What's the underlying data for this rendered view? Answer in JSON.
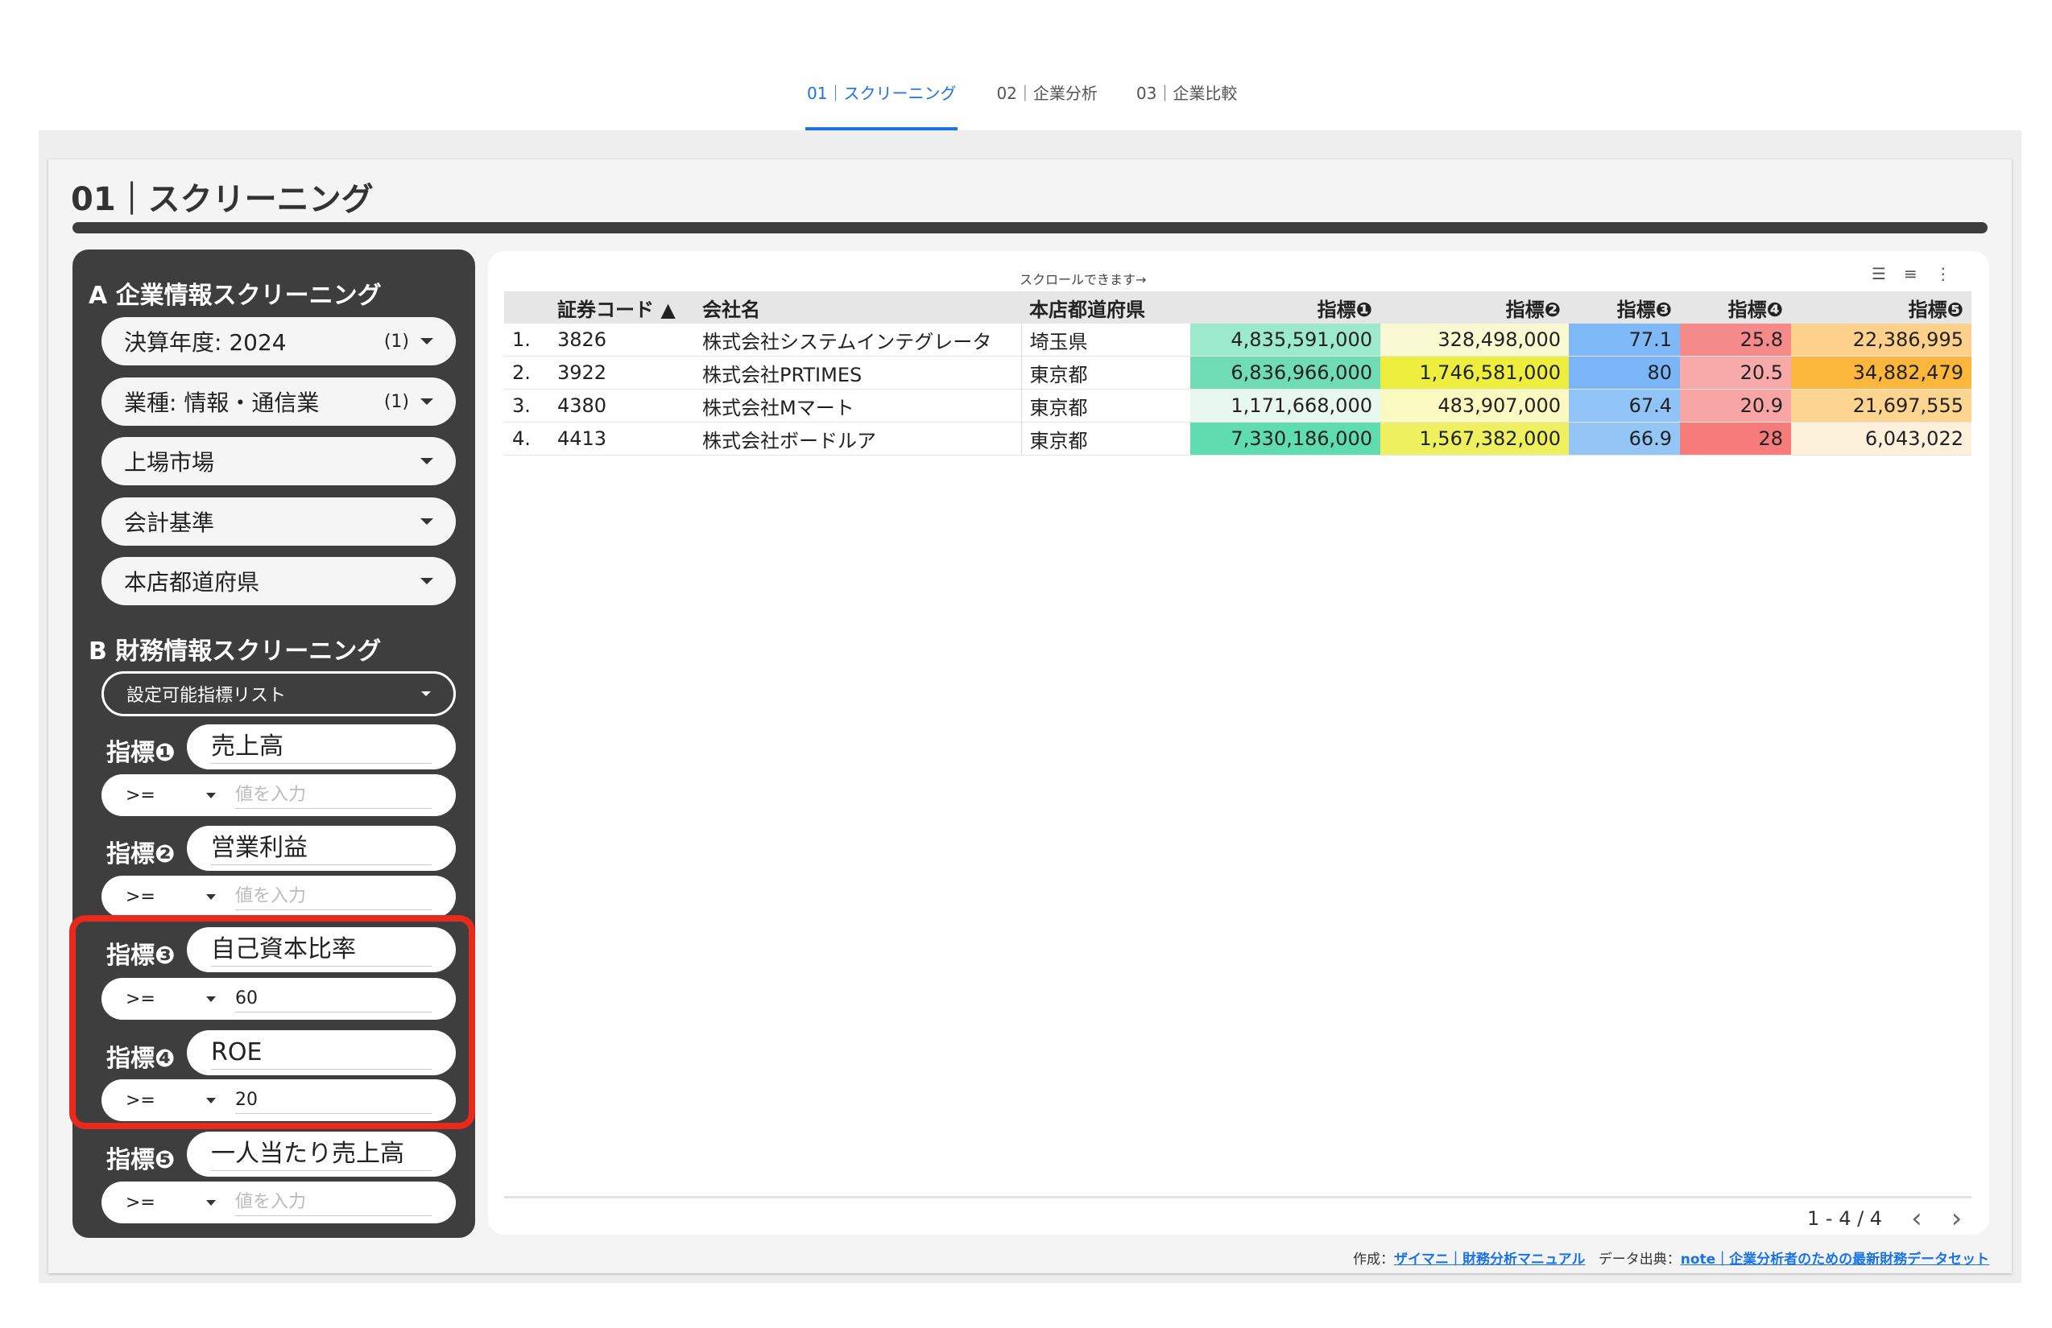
{
  "nav": {
    "tabs": [
      {
        "label": "01｜スクリーニング"
      },
      {
        "label": "02｜企業分析"
      },
      {
        "label": "03｜企業比較"
      }
    ]
  },
  "page": {
    "title": "01｜スクリーニング"
  },
  "filters": {
    "section_a_title": "A 企業情報スクリーニング",
    "dropdowns": [
      {
        "label": "決算年度: 2024",
        "count": "(1)"
      },
      {
        "label": "業種: 情報・通信業",
        "count": "(1)"
      },
      {
        "label": "上場市場",
        "count": ""
      },
      {
        "label": "会計基準",
        "count": ""
      },
      {
        "label": "本店都道府県",
        "count": ""
      }
    ],
    "section_b_title": "B 財務情報スクリーニング",
    "indicator_list_label": "設定可能指標リスト",
    "indicators": [
      {
        "label": "指標❶",
        "metric": "売上高",
        "operator": ">=",
        "value": "",
        "placeholder": "値を入力"
      },
      {
        "label": "指標❷",
        "metric": "営業利益",
        "operator": ">=",
        "value": "",
        "placeholder": "値を入力"
      },
      {
        "label": "指標❸",
        "metric": "自己資本比率",
        "operator": ">=",
        "value": "60",
        "placeholder": ""
      },
      {
        "label": "指標❹",
        "metric": "ROE",
        "operator": ">=",
        "value": "20",
        "placeholder": ""
      },
      {
        "label": "指標❺",
        "metric": "一人当たり売上高",
        "operator": ">=",
        "value": "",
        "placeholder": "値を入力"
      }
    ]
  },
  "table": {
    "scroll_hint": "スクロールできます→",
    "columns": [
      "",
      "証券コード ▲",
      "会社名",
      "本店都道府県",
      "指標❶",
      "指標❷",
      "指標❸",
      "指標❹",
      "指標❺"
    ],
    "rows": [
      [
        "1.",
        "3826",
        "株式会社システムインテグレータ",
        "埼玉県",
        "4,835,591,000",
        "328,498,000",
        "77.1",
        "25.8",
        "22,386,995"
      ],
      [
        "2.",
        "3922",
        "株式会社PRTIMES",
        "東京都",
        "6,836,966,000",
        "1,746,581,000",
        "80",
        "20.5",
        "34,882,479"
      ],
      [
        "3.",
        "4380",
        "株式会社Mマート",
        "東京都",
        "1,171,668,000",
        "483,907,000",
        "67.4",
        "20.9",
        "21,697,555"
      ],
      [
        "4.",
        "4413",
        "株式会社ボードルア",
        "東京都",
        "7,330,186,000",
        "1,567,382,000",
        "66.9",
        "28",
        "6,043,022"
      ]
    ],
    "cell_colors": [
      [
        "#9de9cc",
        "#fafad2",
        "#7fb8f7",
        "#f48a8a",
        "#fdd08c"
      ],
      [
        "#6fdcb5",
        "#eeee3f",
        "#7ab5f8",
        "#f8a9a9",
        "#fbb73b"
      ],
      [
        "#e8f8f1",
        "#fafac0",
        "#90c3f7",
        "#f8a5a5",
        "#fdd590"
      ],
      [
        "#5fdcb0",
        "#eef060",
        "#93c5f7",
        "#f67c7c",
        "#fdf1dc"
      ]
    ],
    "pager": "1 - 4 / 4"
  },
  "footer": {
    "made_by_prefix": "作成：",
    "made_by_link": "ザイマニ｜財務分析マニュアル",
    "source_prefix": "データ出典：",
    "source_link": "note｜企業分析者のための最新財務データセット"
  }
}
